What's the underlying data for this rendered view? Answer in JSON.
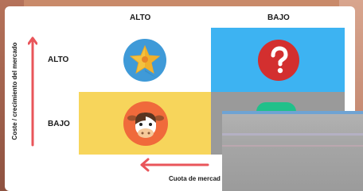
{
  "columns": {
    "high": "ALTO",
    "low": "BAJO"
  },
  "rows": {
    "high": "ALTO",
    "low": "BAJO"
  },
  "y_axis_label": "Coste / crecimiento del mercado",
  "x_axis_label": "Cuota de mercad",
  "quadrants": [
    {
      "icon": "star-icon",
      "color": "#ffffff",
      "badge_color": "#3f9ad8"
    },
    {
      "icon": "question-mark-icon",
      "color": "#3db3f2",
      "badge_color": "#d32f2f"
    },
    {
      "icon": "cow-icon",
      "color": "#f7d55b",
      "badge_color": "#f06a3b"
    },
    {
      "icon": "dog-icon",
      "color": "#9a9a9a",
      "badge_color": "#20c08a"
    }
  ],
  "colors": {
    "arrow": "#e9555a"
  }
}
